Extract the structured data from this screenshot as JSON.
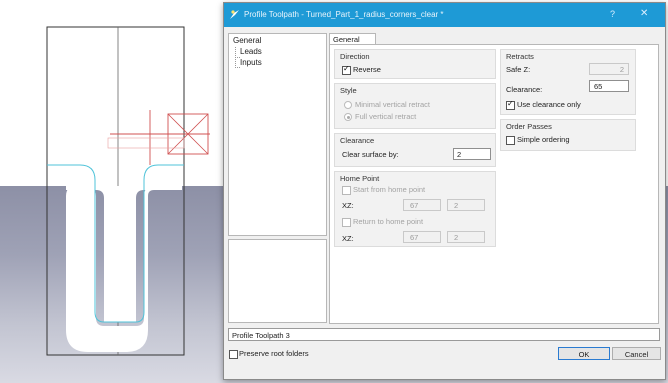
{
  "dialog": {
    "title": "Profile Toolpath - Turned_Part_1_radius_corners_clear *",
    "help_label": "?",
    "close_label": "✕"
  },
  "tree": {
    "items": [
      "General",
      "Leads",
      "Inputs"
    ]
  },
  "tabs": {
    "general": "General"
  },
  "direction": {
    "title": "Direction",
    "reverse_label": "Reverse",
    "reverse_checked": true
  },
  "style": {
    "title": "Style",
    "minimal_label": "Minimal vertical retract",
    "full_label": "Full vertical retract"
  },
  "clearance": {
    "title": "Clearance",
    "clear_surface_label": "Clear surface by:",
    "clear_surface_value": "2"
  },
  "home_point": {
    "title": "Home Point",
    "start_label": "Start from home point",
    "xz1_label": "XZ:",
    "xz1_x": "67",
    "xz1_z": "2",
    "return_label": "Return to home point",
    "xz2_label": "XZ:",
    "xz2_x": "67",
    "xz2_z": "2"
  },
  "retracts": {
    "title": "Retracts",
    "safe_z_label": "Safe Z:",
    "safe_z_value": "2",
    "clearance_label": "Clearance:",
    "clearance_value": "65",
    "use_clearance_label": "Use clearance only",
    "use_clearance_checked": true
  },
  "order_passes": {
    "title": "Order Passes",
    "simple_label": "Simple ordering"
  },
  "footer": {
    "toolpath_name": "Profile Toolpath 3",
    "preserve_label": "Preserve root folders",
    "ok_label": "OK",
    "cancel_label": "Cancel"
  },
  "colors": {
    "titlebar": "#1e9ad6",
    "annotation": "#c9443f",
    "toolpath_line": "#4fc3d9",
    "crosshair": "#d05050"
  }
}
